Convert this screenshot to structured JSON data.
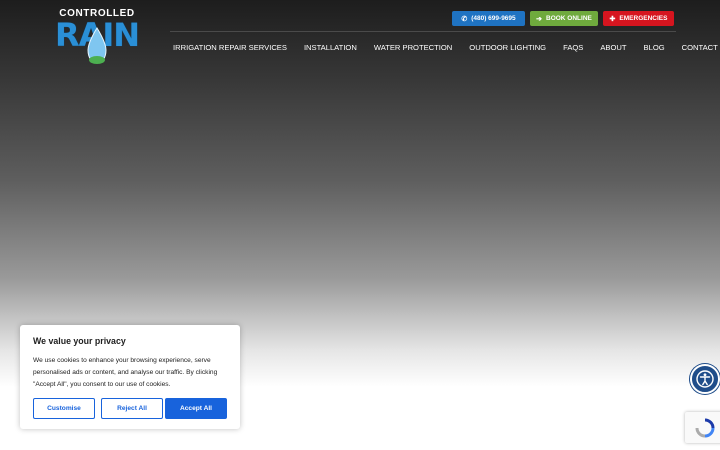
{
  "logo": {
    "top_text": "CONTROLLED",
    "main_text": "RAIN"
  },
  "top_buttons": {
    "phone": "(480) 699-9695",
    "book": "BOOK ONLINE",
    "emergencies": "EMERGENCIES"
  },
  "nav": [
    "IRRIGATION REPAIR SERVICES",
    "INSTALLATION",
    "WATER PROTECTION",
    "OUTDOOR LIGHTING",
    "FAQS",
    "ABOUT",
    "BLOG",
    "CONTACT US"
  ],
  "cookie": {
    "title": "We value your privacy",
    "body": "We use cookies to enhance your browsing experience, serve personalised ads or content, and analyse our traffic. By clicking \"Accept All\", you consent to our use of cookies.",
    "customise": "Customise",
    "reject": "Reject All",
    "accept": "Accept All"
  },
  "icons": {
    "phone": "phone-icon",
    "book": "arrow-right-icon",
    "emergencies": "alert-icon",
    "accessibility": "accessibility-icon",
    "recaptcha": "recaptcha-icon"
  },
  "colors": {
    "phone_button": "#1f73c2",
    "book_button": "#6faa3d",
    "emergency_button": "#d6151f",
    "cookie_accent": "#1863dc",
    "logo_blue": "#2a8fd6"
  }
}
